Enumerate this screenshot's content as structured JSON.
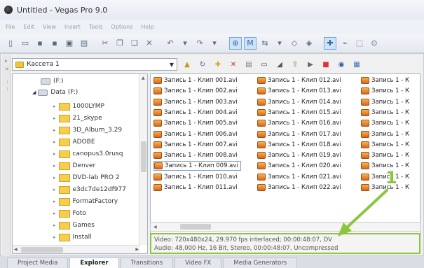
{
  "window": {
    "title": "Untitled - Vegas Pro 9.0"
  },
  "menu": [
    "File",
    "Edit",
    "View",
    "Insert",
    "Tools",
    "Options",
    "Help"
  ],
  "explorer": {
    "path": "Кассета 1",
    "tree": {
      "drive_f": "(F:)",
      "data_drive": "Data (F:)",
      "folders": [
        "1000LYMP",
        "21_skype",
        "3D_Album_3.29",
        "ADOBE",
        "canopus3.0rusq",
        "Denver",
        "DVD-lab PRO 2",
        "e3dc7de12df977",
        "FormatFactory",
        "Foto",
        "Games",
        "Install"
      ]
    },
    "files": [
      [
        "Запись 1 - Клип 001.avi",
        "Запись 1 - Клип 002.avi",
        "Запись 1 - Клип 003.avi",
        "Запись 1 - Клип 004.avi",
        "Запись 1 - Клип 005.avi",
        "Запись 1 - Клип 006.avi",
        "Запись 1 - Клип 007.avi",
        "Запись 1 - Клип 008.avi",
        "Запись 1 - Клип 009.avi",
        "Запись 1 - Клип 010.avi",
        "Запись 1 - Клип 011.avi"
      ],
      [
        "Запись 1 - Клип 012.avi",
        "Запись 1 - Клип 013.avi",
        "Запись 1 - Клип 014.avi",
        "Запись 1 - Клип 015.avi",
        "Запись 1 - Клип 016.avi",
        "Запись 1 - Клип 017.avi",
        "Запись 1 - Клип 018.avi",
        "Запись 1 - Клип 019.avi",
        "Запись 1 - Клип 020.avi",
        "Запись 1 - Клип 021.avi",
        "Запись 1 - Клип 022.avi"
      ],
      [
        "Запись 1 - К",
        "Запись 1 - К",
        "Запись 1 - К",
        "Запись 1 - К",
        "Запись 1 - К",
        "Запись 1 - К",
        "Запись 1 - К",
        "Запись 1 - К",
        "Запись 1 - К",
        "Запись 1 - К",
        "Запись 1 - К"
      ]
    ],
    "selected_file": "Запись 1 - Клип 009.avi",
    "info": {
      "video": "Video: 720x480x24, 29.970 fps interlaced; 00:00:48:07, DV",
      "audio": "Audio: 48,000 Hz, 16 Bit, Stereo, 00:00:48:07, Uncompressed"
    }
  },
  "annotation": {
    "label": "1",
    "color": "#8cc63f"
  },
  "tabs": [
    "Project Media",
    "Explorer",
    "Transitions",
    "Video FX",
    "Media Generators"
  ]
}
